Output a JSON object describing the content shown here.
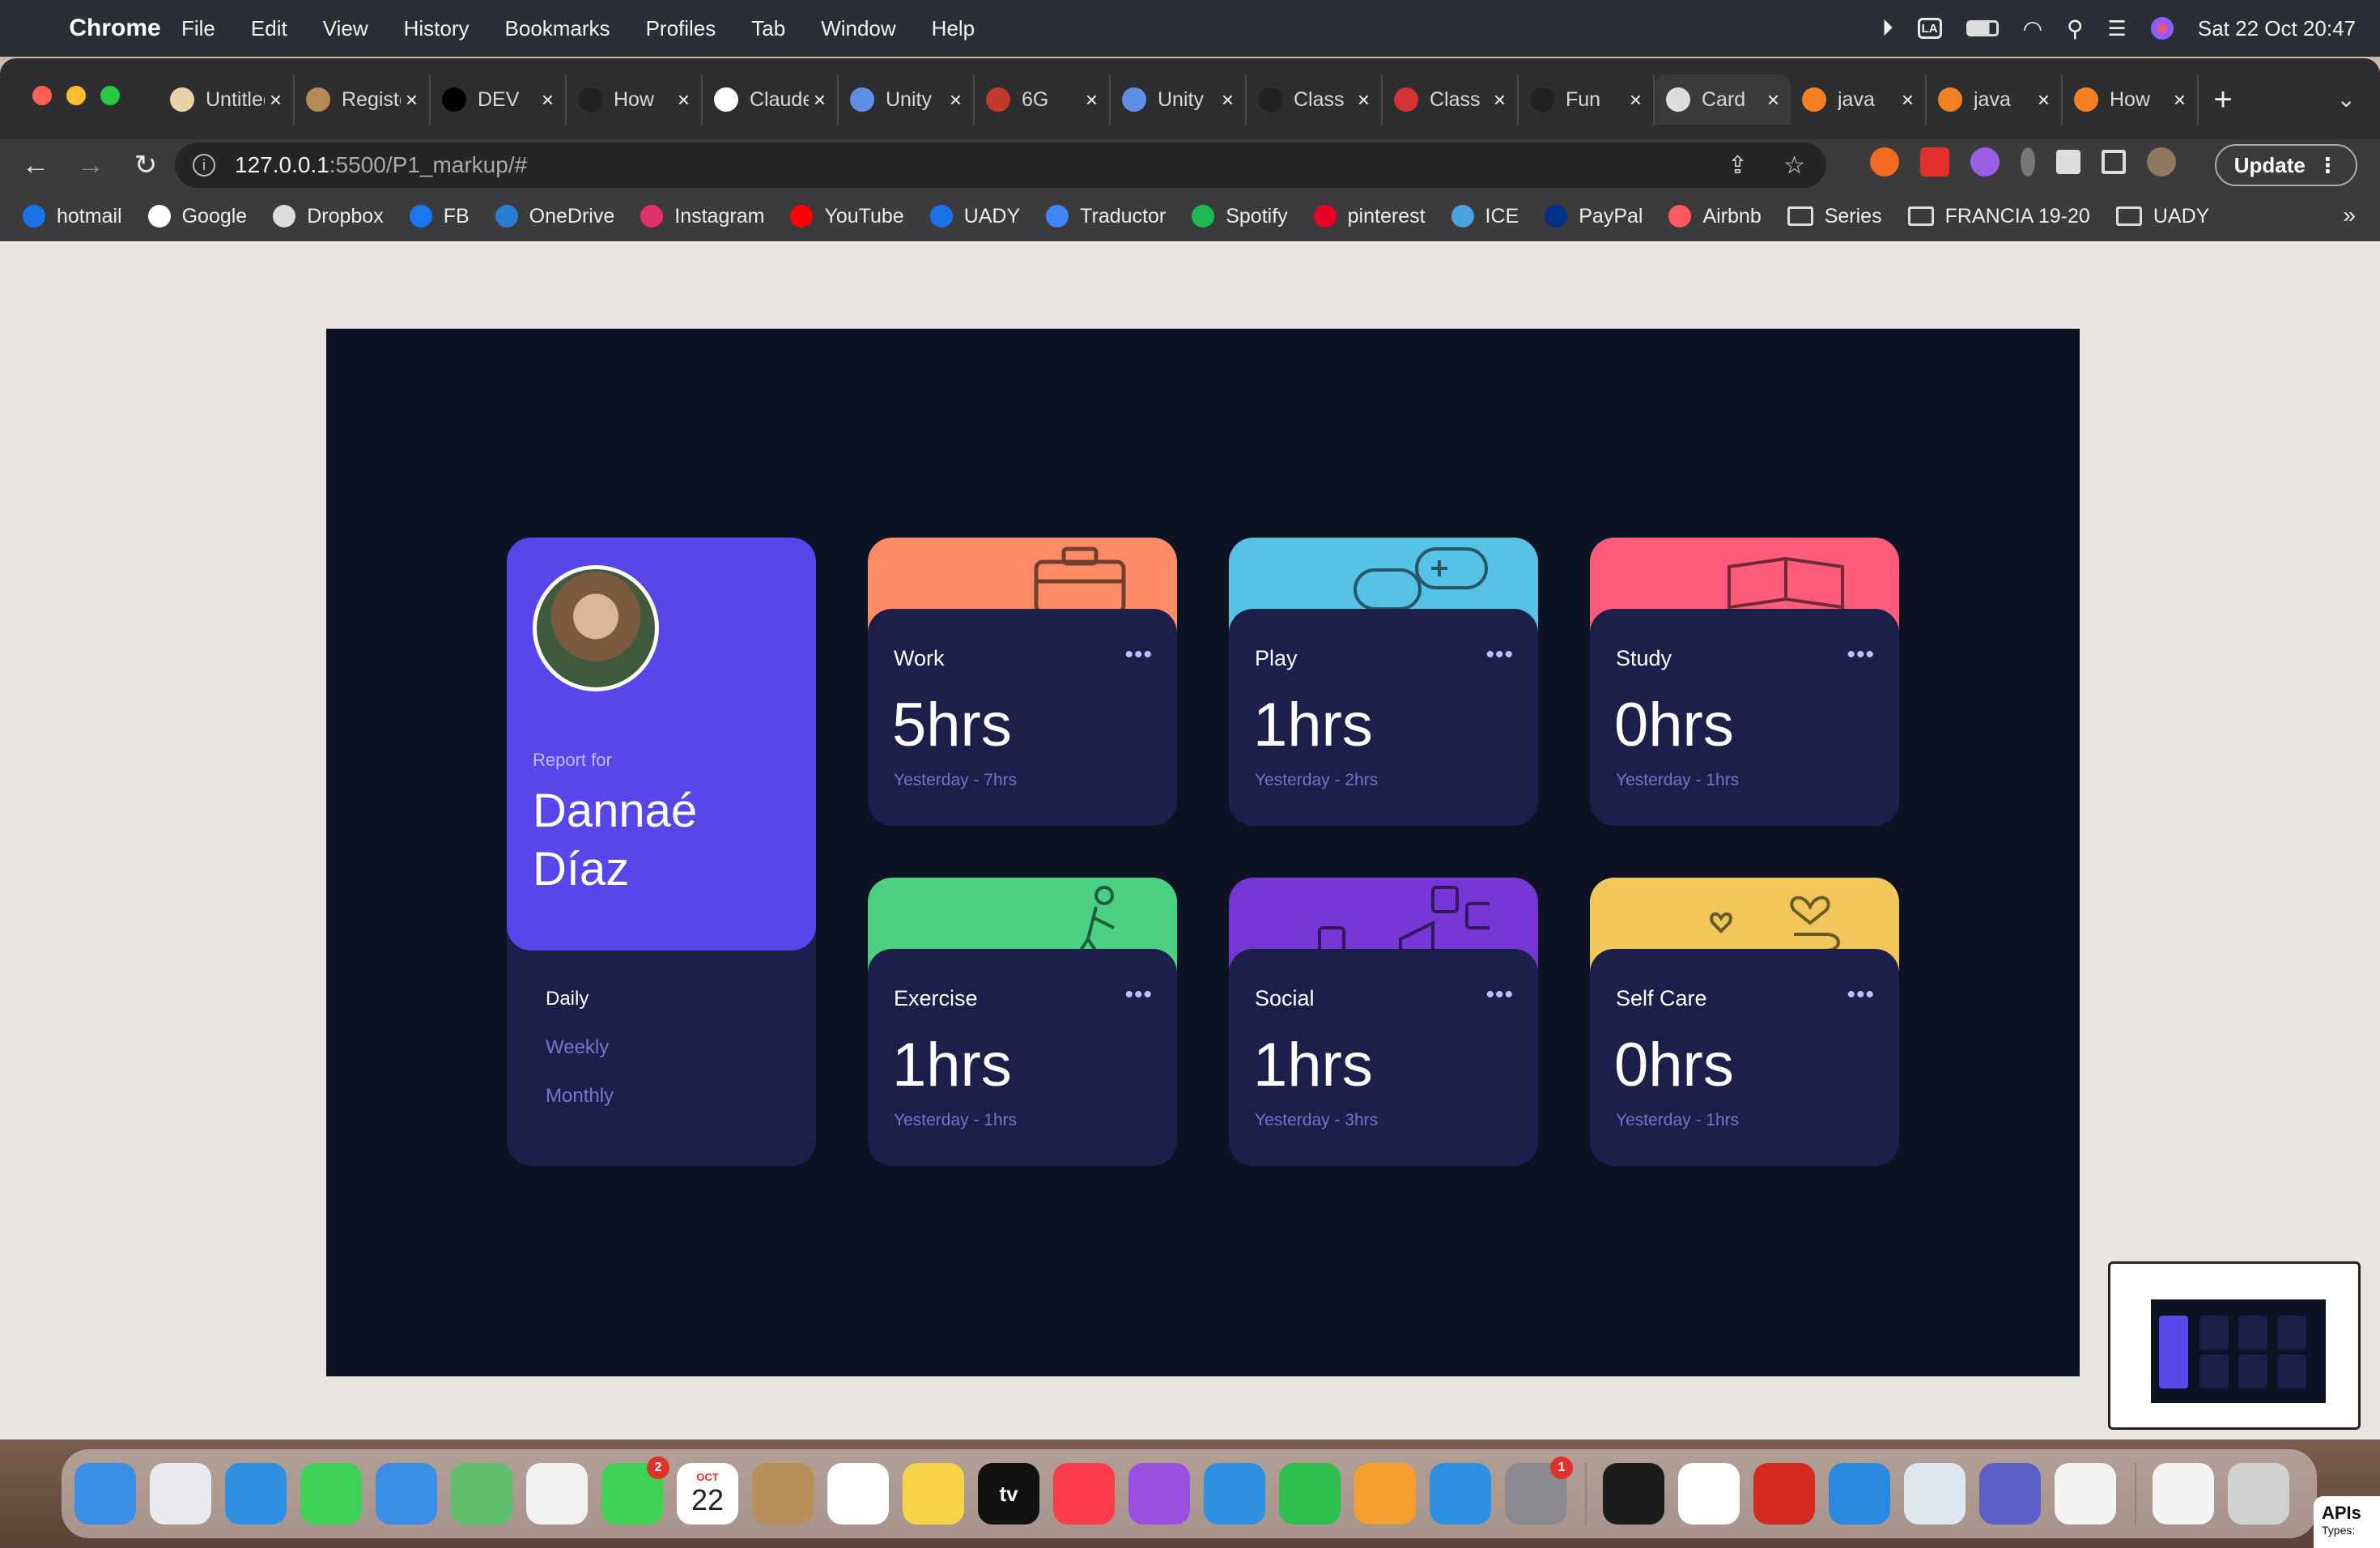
{
  "menubar": {
    "app_name": "Chrome",
    "items": [
      "File",
      "Edit",
      "View",
      "History",
      "Bookmarks",
      "Profiles",
      "Tab",
      "Window",
      "Help"
    ],
    "keyboard": "LA",
    "datetime": "Sat 22 Oct  20:47"
  },
  "tabs": [
    {
      "title": "Untitled",
      "icon": "ghost-icon",
      "color": "#e8d3a8"
    },
    {
      "title": "Register",
      "icon": "circle-avatar-icon",
      "color": "#b48a56"
    },
    {
      "title": "DEV",
      "icon": "dev-logo-icon",
      "color": "#000000"
    },
    {
      "title": "How",
      "icon": "m-logo-icon",
      "color": "#222222"
    },
    {
      "title": "Claude",
      "icon": "github-icon",
      "color": "#ffffff"
    },
    {
      "title": "Unity",
      "icon": "mountain-logo-icon",
      "color": "#5f8ee8"
    },
    {
      "title": "6G",
      "icon": "shield-k-icon",
      "color": "#c0392b"
    },
    {
      "title": "Unity",
      "icon": "mountain-logo-icon",
      "color": "#5f8ee8"
    },
    {
      "title": "Class",
      "icon": "m-logo-icon",
      "color": "#222222"
    },
    {
      "title": "Class",
      "icon": "dancer-icon",
      "color": "#d33333"
    },
    {
      "title": "Fun",
      "icon": "m-logo-icon",
      "color": "#222222"
    },
    {
      "title": "Card",
      "icon": "globe-icon",
      "color": "#dddddd",
      "active": true
    },
    {
      "title": "java",
      "icon": "stackoverflow-icon",
      "color": "#f48024"
    },
    {
      "title": "java",
      "icon": "stackoverflow-icon",
      "color": "#f48024"
    },
    {
      "title": "How",
      "icon": "stackoverflow-icon",
      "color": "#f48024"
    }
  ],
  "address": {
    "host": "127.0.0.1",
    "path": ":5500/P1_markup/#",
    "update_label": "Update"
  },
  "bookmarks": [
    {
      "label": "hotmail",
      "icon": "outlook-icon",
      "color": "#1a73e8"
    },
    {
      "label": "Google",
      "icon": "google-icon",
      "color": "#ffffff"
    },
    {
      "label": "Dropbox",
      "icon": "globe-icon",
      "color": "#dddddd"
    },
    {
      "label": "FB",
      "icon": "facebook-icon",
      "color": "#1877f2"
    },
    {
      "label": "OneDrive",
      "icon": "cloud-icon",
      "color": "#2b7cd3"
    },
    {
      "label": "Instagram",
      "icon": "instagram-icon",
      "color": "#e1306c"
    },
    {
      "label": "YouTube",
      "icon": "youtube-icon",
      "color": "#ff0000"
    },
    {
      "label": "UADY",
      "icon": "outlook-icon",
      "color": "#1a73e8"
    },
    {
      "label": "Traductor",
      "icon": "translate-icon",
      "color": "#4285f4"
    },
    {
      "label": "Spotify",
      "icon": "spotify-icon",
      "color": "#1db954"
    },
    {
      "label": "pinterest",
      "icon": "pinterest-icon",
      "color": "#e60023"
    },
    {
      "label": "ICE",
      "icon": "ice-icon",
      "color": "#4aa3df"
    },
    {
      "label": "PayPal",
      "icon": "paypal-icon",
      "color": "#003087"
    },
    {
      "label": "Airbnb",
      "icon": "airbnb-icon",
      "color": "#ff5a5f"
    },
    {
      "label": "Series",
      "icon": "folder-icon",
      "folder": true
    },
    {
      "label": "FRANCIA 19-20",
      "icon": "folder-icon",
      "folder": true
    },
    {
      "label": "UADY",
      "icon": "folder-icon",
      "folder": true
    }
  ],
  "dashboard": {
    "profile": {
      "report_for": "Report for",
      "first_name": "Dannaé",
      "last_name": "Díaz"
    },
    "periods": [
      "Daily",
      "Weekly",
      "Monthly"
    ],
    "active_period": "Daily",
    "activities": [
      {
        "title": "Work",
        "hours": "5hrs",
        "previous": "Yesterday - 7hrs",
        "color": "#ff8c66",
        "icon": "briefcase-icon"
      },
      {
        "title": "Play",
        "hours": "1hrs",
        "previous": "Yesterday - 2hrs",
        "color": "#56c2e6",
        "icon": "gamepad-icon"
      },
      {
        "title": "Study",
        "hours": "0hrs",
        "previous": "Yesterday - 1hrs",
        "color": "#ff5c7c",
        "icon": "book-icon"
      },
      {
        "title": "Exercise",
        "hours": "1hrs",
        "previous": "Yesterday - 1hrs",
        "color": "#4bcf82",
        "icon": "running-icon"
      },
      {
        "title": "Social",
        "hours": "1hrs",
        "previous": "Yesterday - 3hrs",
        "color": "#7536d3",
        "icon": "social-icons-icon"
      },
      {
        "title": "Self Care",
        "hours": "0hrs",
        "previous": "Yesterday - 1hrs",
        "color": "#f1c65b",
        "icon": "heart-hand-icon"
      }
    ]
  },
  "dock": {
    "apps": [
      {
        "name": "Finder",
        "color": "#3a8ee6"
      },
      {
        "name": "Launchpad",
        "color": "#e9e9ee"
      },
      {
        "name": "Safari",
        "color": "#2f8fe3"
      },
      {
        "name": "Messages",
        "color": "#3fd158"
      },
      {
        "name": "Mail",
        "color": "#3a8ee6"
      },
      {
        "name": "Maps",
        "color": "#5fbf6a"
      },
      {
        "name": "Photos",
        "color": "#f0f0f0"
      },
      {
        "name": "FaceTime",
        "color": "#3fd158",
        "badge": "2"
      },
      {
        "name": "Calendar",
        "color": "#ffffff",
        "month": "OCT",
        "day": "22"
      },
      {
        "name": "Contacts",
        "color": "#b68f5a"
      },
      {
        "name": "Reminders",
        "color": "#ffffff"
      },
      {
        "name": "Notes",
        "color": "#f8d34a"
      },
      {
        "name": "TV",
        "color": "#111111",
        "label": "tv"
      },
      {
        "name": "Music",
        "color": "#fa3c4c"
      },
      {
        "name": "Podcasts",
        "color": "#9a4fe0"
      },
      {
        "name": "Keynote",
        "color": "#2f8fe3"
      },
      {
        "name": "Numbers",
        "color": "#2fbf4f"
      },
      {
        "name": "Pages",
        "color": "#f4a030"
      },
      {
        "name": "App Store",
        "color": "#2f8fe3"
      },
      {
        "name": "System Preferences",
        "color": "#8a8a8f",
        "badge": "1"
      },
      {
        "name": "Terminal",
        "color": "#1c1c1c"
      },
      {
        "name": "Chrome",
        "color": "#ffffff"
      },
      {
        "name": "Acrobat",
        "color": "#d32a1f"
      },
      {
        "name": "VS Code",
        "color": "#2a8ae0"
      },
      {
        "name": "Preview",
        "color": "#dfe7ee"
      },
      {
        "name": "Teams",
        "color": "#5b5fc7"
      },
      {
        "name": "TextEdit",
        "color": "#f3f3f3"
      },
      {
        "name": "Documents",
        "color": "#f3f3f3"
      },
      {
        "name": "Trash",
        "color": "#d0d0d0"
      }
    ]
  },
  "corner_widget": {
    "title": "APIs",
    "subtitle": "Types:"
  }
}
